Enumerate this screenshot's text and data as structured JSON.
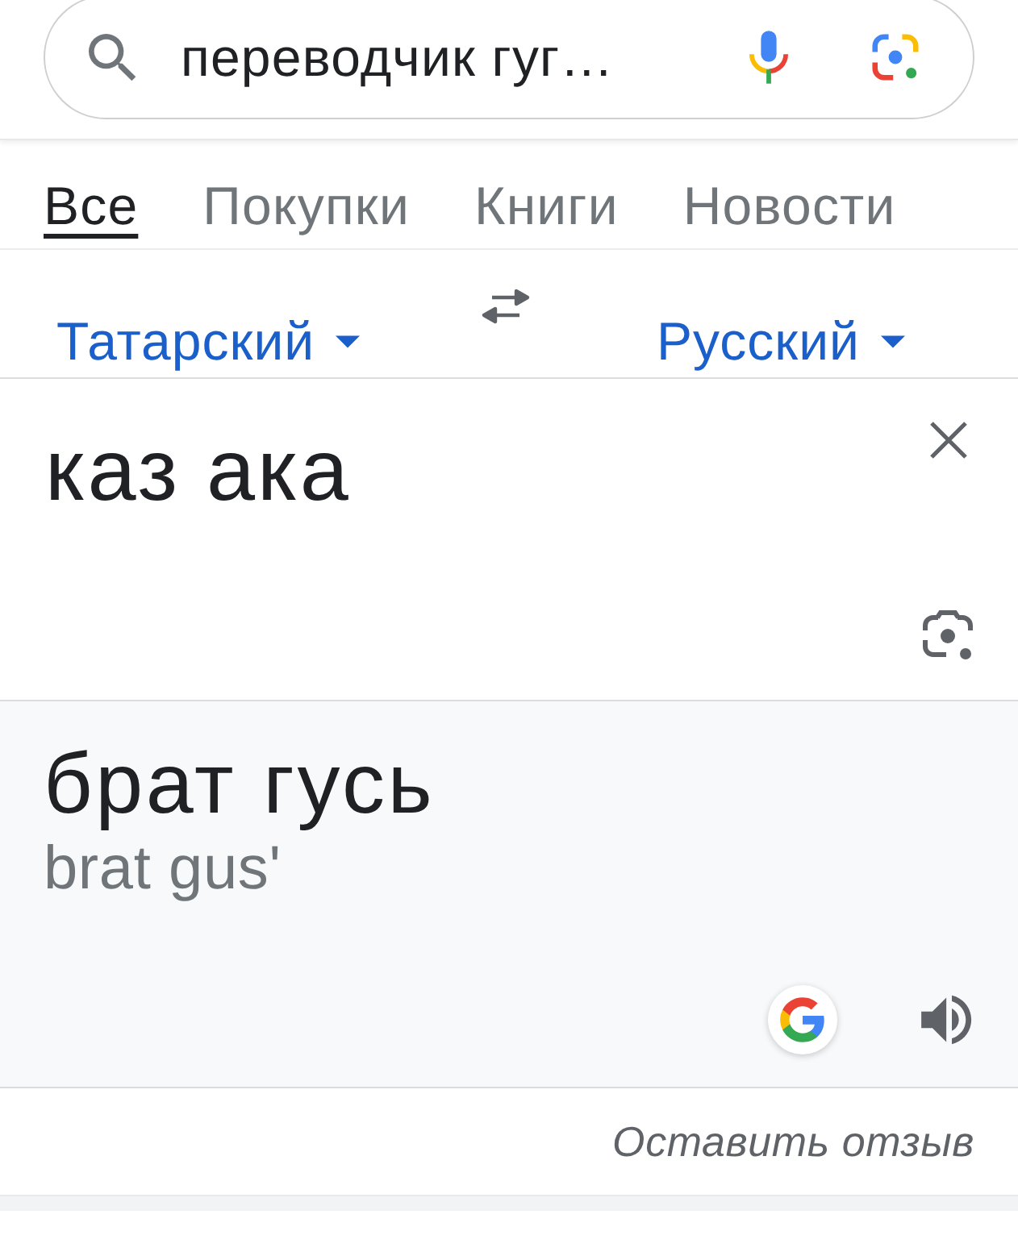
{
  "search": {
    "query": "переводчик гуг…"
  },
  "tabs": [
    {
      "label": "Все",
      "selected": true
    },
    {
      "label": "Покупки",
      "selected": false
    },
    {
      "label": "Книги",
      "selected": false
    },
    {
      "label": "Новости",
      "selected": false
    }
  ],
  "translator": {
    "source_language": "Татарский",
    "target_language": "Русский",
    "input": "каз ака",
    "translation": "брат гусь",
    "transliteration": "brat gus'"
  },
  "feedback_link": "Оставить отзыв"
}
